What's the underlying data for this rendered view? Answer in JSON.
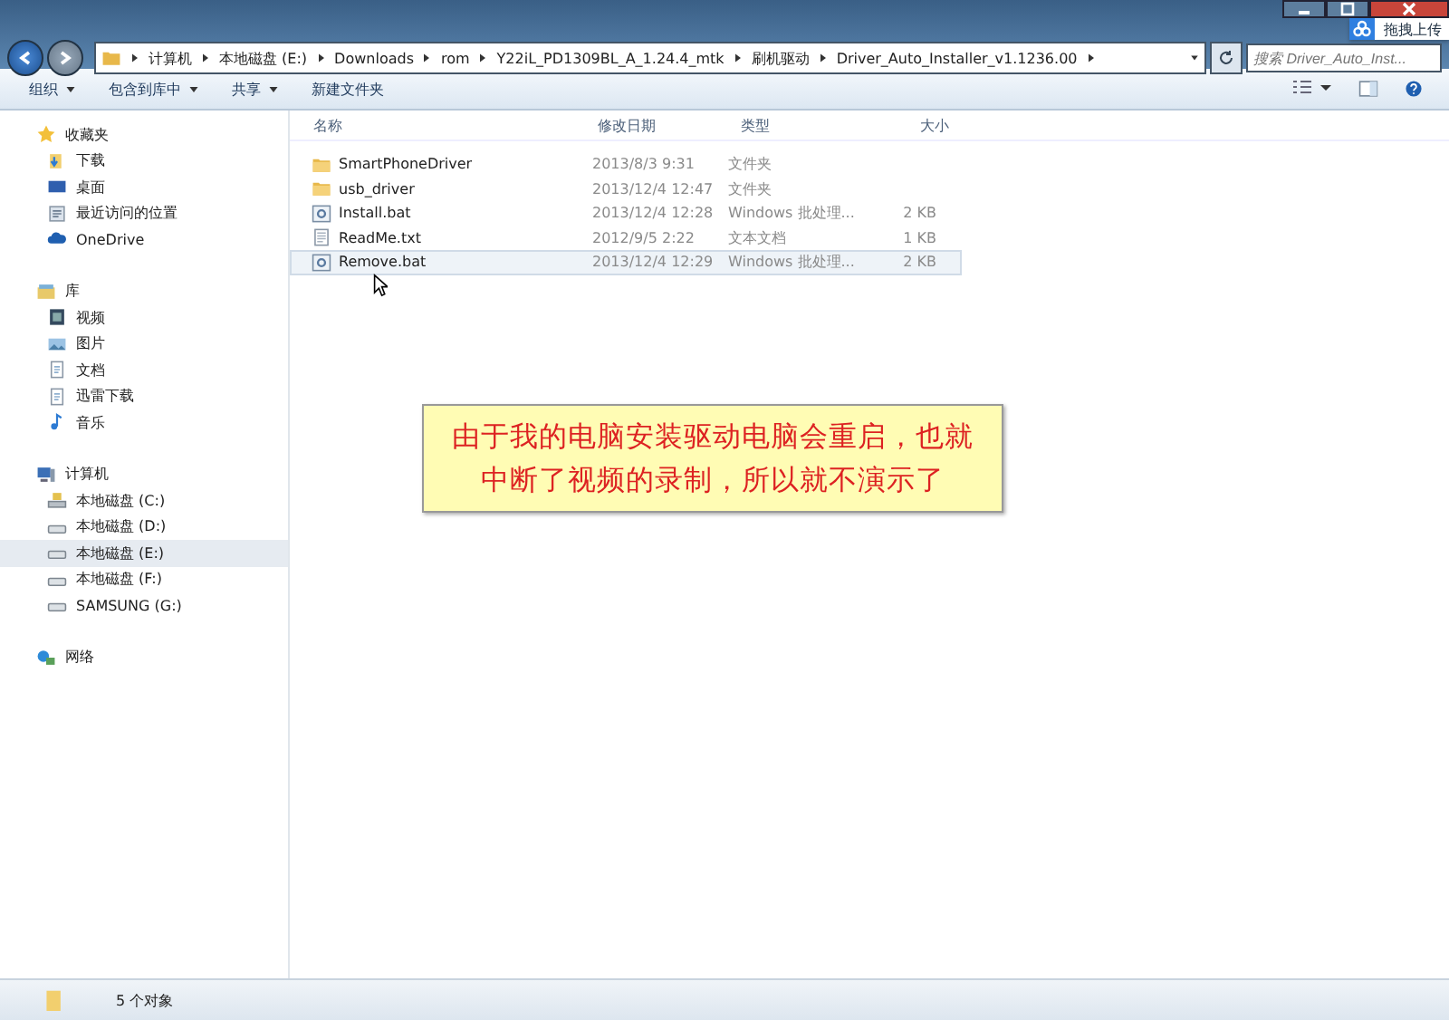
{
  "address_bar": {
    "segments": [
      "计算机",
      "本地磁盘 (E:)",
      "Downloads",
      "rom",
      "Y22iL_PD1309BL_A_1.24.4_mtk",
      "刷机驱动",
      "Driver_Auto_Installer_v1.1236.00"
    ]
  },
  "search": {
    "placeholder": "搜索 Driver_Auto_Inst..."
  },
  "upload_badge": {
    "label": "拖拽上传"
  },
  "toolbar": {
    "items": [
      {
        "label": "组织",
        "dropdown": true
      },
      {
        "label": "包含到库中",
        "dropdown": true
      },
      {
        "label": "共享",
        "dropdown": true
      },
      {
        "label": "新建文件夹",
        "dropdown": false
      }
    ]
  },
  "sidebar": {
    "groups": [
      {
        "label": "收藏夹",
        "kind": "star",
        "items": [
          {
            "label": "下载",
            "kind": "download",
            "selected": false
          },
          {
            "label": "桌面",
            "kind": "desktop",
            "selected": false
          },
          {
            "label": "最近访问的位置",
            "kind": "recent",
            "selected": false
          },
          {
            "label": "OneDrive",
            "kind": "cloud",
            "selected": false
          }
        ]
      },
      {
        "label": "库",
        "kind": "library",
        "items": [
          {
            "label": "视频",
            "kind": "video",
            "selected": false
          },
          {
            "label": "图片",
            "kind": "picture",
            "selected": false
          },
          {
            "label": "文档",
            "kind": "doc",
            "selected": false
          },
          {
            "label": "迅雷下载",
            "kind": "doc",
            "selected": false
          },
          {
            "label": "音乐",
            "kind": "music",
            "selected": false
          }
        ]
      },
      {
        "label": "计算机",
        "kind": "computer",
        "items": [
          {
            "label": "本地磁盘 (C:)",
            "kind": "sysdrive",
            "selected": false
          },
          {
            "label": "本地磁盘 (D:)",
            "kind": "drive",
            "selected": false
          },
          {
            "label": "本地磁盘 (E:)",
            "kind": "drive",
            "selected": true
          },
          {
            "label": "本地磁盘 (F:)",
            "kind": "drive",
            "selected": false
          },
          {
            "label": "SAMSUNG (G:)",
            "kind": "drive",
            "selected": false
          }
        ]
      },
      {
        "label": "网络",
        "kind": "network"
      }
    ]
  },
  "table": {
    "columns": [
      "名称",
      "修改日期",
      "类型",
      "大小"
    ],
    "rows": [
      {
        "name": "SmartPhoneDriver",
        "kind": "folder",
        "date": "2013/8/3 9:31",
        "type": "文件夹",
        "selected": false
      },
      {
        "name": "usb_driver",
        "kind": "folder",
        "date": "2013/12/4 12:47",
        "type": "文件夹",
        "selected": false
      },
      {
        "name": "Install.bat",
        "kind": "bat",
        "date": "2013/12/4 12:28",
        "type": "Windows 批处理...",
        "size": "2 KB",
        "selected": false
      },
      {
        "name": "ReadMe.txt",
        "kind": "txt",
        "date": "2012/9/5 2:22",
        "type": "文本文档",
        "size": "1 KB",
        "selected": false
      },
      {
        "name": "Remove.bat",
        "kind": "bat",
        "date": "2013/12/4 12:29",
        "type": "Windows 批处理...",
        "size": "2 KB",
        "selected": true
      }
    ]
  },
  "callout": {
    "text": "由于我的电脑安装驱动电脑会重启，也就中断了视频的录制，所以就不演示了"
  },
  "status_bar": {
    "text": "5 个对象"
  }
}
